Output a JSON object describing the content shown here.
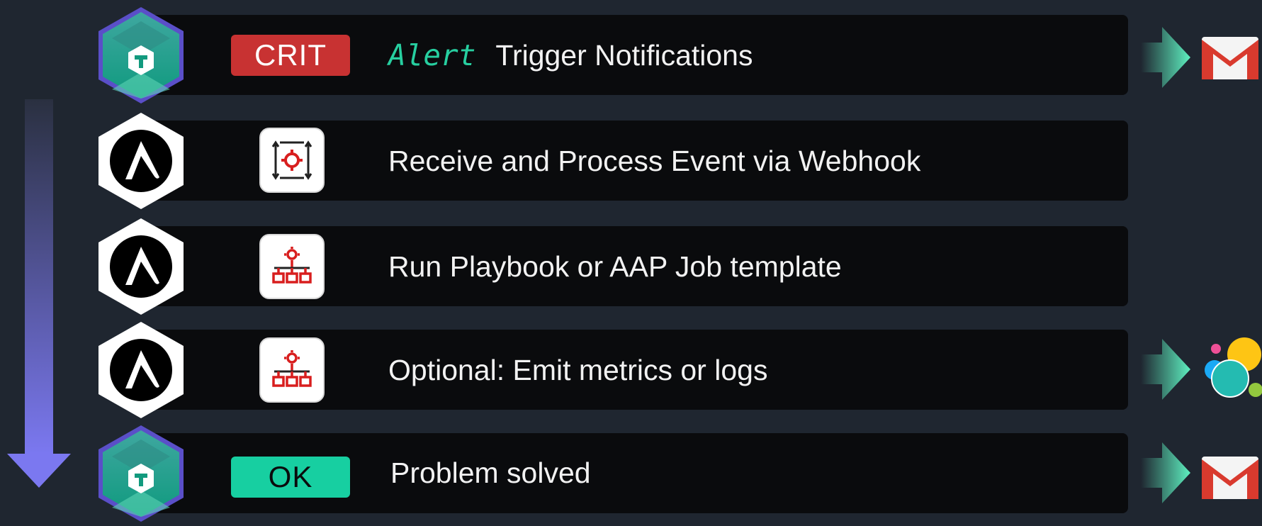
{
  "steps": [
    {
      "badge": "CRIT",
      "prefix": "Alert",
      "text": "Trigger Notifications",
      "actor_icon": "checkmk-icon",
      "output_icon": "gmail-icon"
    },
    {
      "text": "Receive and Process Event via Webhook",
      "actor_icon": "ansible-icon",
      "step_icon": "event-driven-icon"
    },
    {
      "text": "Run Playbook or AAP Job template",
      "actor_icon": "ansible-icon",
      "step_icon": "job-template-icon"
    },
    {
      "text": "Optional: Emit metrics or logs",
      "actor_icon": "ansible-icon",
      "step_icon": "job-template-icon",
      "output_icon": "elastic-icon"
    },
    {
      "badge": "OK",
      "text": "Problem solved",
      "actor_icon": "checkmk-icon",
      "output_icon": "gmail-icon"
    }
  ],
  "colors": {
    "background": "#1f2630",
    "row": "#0a0b0d",
    "crit": "#c83232",
    "ok": "#17cfa1",
    "accent_green": "#27cfa0",
    "flow_arrow": "#7b78f0"
  }
}
